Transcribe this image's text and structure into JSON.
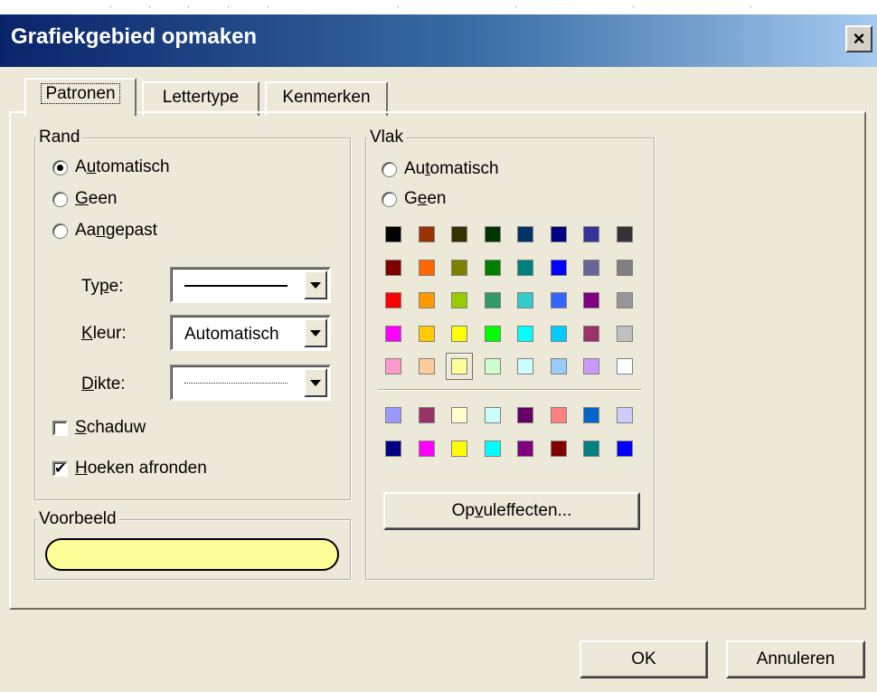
{
  "window": {
    "title": "Grafiekgebied opmaken",
    "close_label": "×"
  },
  "tabs": [
    {
      "label": "Patronen",
      "active": true
    },
    {
      "label": "Lettertype",
      "active": false
    },
    {
      "label": "Kenmerken",
      "active": false
    }
  ],
  "rand": {
    "legend": "Rand",
    "options": [
      {
        "pre": "A",
        "key": "u",
        "post": "tomatisch",
        "checked": true
      },
      {
        "pre": "",
        "key": "G",
        "post": "een",
        "checked": false
      },
      {
        "pre": "Aa",
        "key": "n",
        "post": "gepast",
        "checked": false
      }
    ],
    "type": {
      "pre": "Ty",
      "key": "p",
      "post": "e:"
    },
    "kleur": {
      "pre": "",
      "key": "K",
      "post": "leur:",
      "value": "Automatisch"
    },
    "dikte": {
      "pre": "",
      "key": "D",
      "post": "ikte:"
    },
    "schaduw": {
      "pre": "",
      "key": "S",
      "post": "chaduw",
      "checked": false
    },
    "hoeken": {
      "pre": "",
      "key": "H",
      "post": "oeken afronden",
      "checked": true,
      "check_glyph": "✔"
    }
  },
  "voorbeeld": {
    "legend": "Voorbeeld",
    "fill_color": "#ffff99"
  },
  "vlak": {
    "legend": "Vlak",
    "options": [
      {
        "pre": "Au",
        "key": "t",
        "post": "omatisch",
        "checked": false
      },
      {
        "pre": "G",
        "key": "e",
        "post": "en",
        "checked": false
      }
    ],
    "palette": [
      [
        "#000000",
        "#993300",
        "#333300",
        "#003300",
        "#003366",
        "#000080",
        "#333399",
        "#333333"
      ],
      [
        "#800000",
        "#ff6600",
        "#808000",
        "#008000",
        "#008080",
        "#0000ff",
        "#666699",
        "#808080"
      ],
      [
        "#ff0000",
        "#ff9900",
        "#99cc00",
        "#339966",
        "#33cccc",
        "#3366ff",
        "#800080",
        "#969696"
      ],
      [
        "#ff00ff",
        "#ffcc00",
        "#ffff00",
        "#00ff00",
        "#00ffff",
        "#00ccff",
        "#993366",
        "#c0c0c0"
      ],
      [
        "#ff99cc",
        "#ffcc99",
        "#ffff99",
        "#ccffcc",
        "#ccffff",
        "#99ccff",
        "#cc99ff",
        "#ffffff"
      ]
    ],
    "selected": {
      "row": 4,
      "col": 2
    },
    "chart_palette": [
      [
        "#9999ff",
        "#993366",
        "#ffffcc",
        "#ccffff",
        "#660066",
        "#ff8080",
        "#0066cc",
        "#ccccff"
      ],
      [
        "#000080",
        "#ff00ff",
        "#ffff00",
        "#00ffff",
        "#800080",
        "#800000",
        "#008080",
        "#0000ff"
      ]
    ],
    "fill_effects": {
      "pre": "Op",
      "key": "v",
      "post": "uleffecten..."
    }
  },
  "buttons": {
    "ok": "OK",
    "cancel": "Annuleren"
  }
}
